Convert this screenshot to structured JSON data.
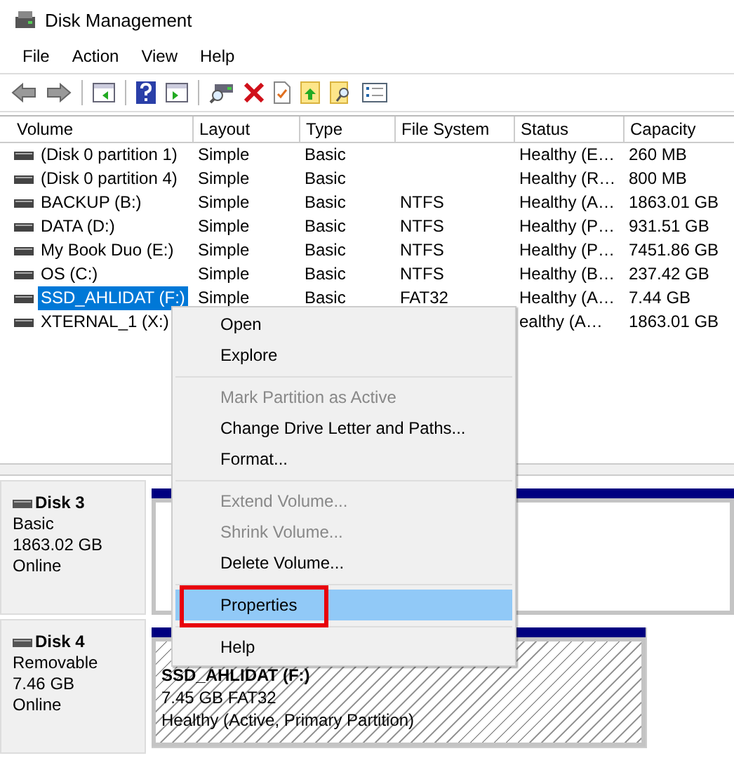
{
  "window": {
    "title": "Disk Management"
  },
  "menu_bar": [
    "File",
    "Action",
    "View",
    "Help"
  ],
  "toolbar": [
    {
      "kind": "back"
    },
    {
      "kind": "forward"
    },
    {
      "kind": "sep"
    },
    {
      "kind": "pane-left"
    },
    {
      "kind": "sep"
    },
    {
      "kind": "help"
    },
    {
      "kind": "pane-right"
    },
    {
      "kind": "sep"
    },
    {
      "kind": "connect"
    },
    {
      "kind": "delete"
    },
    {
      "kind": "check"
    },
    {
      "kind": "folder-up"
    },
    {
      "kind": "folder-search"
    },
    {
      "kind": "list"
    }
  ],
  "table": {
    "columns": [
      "Volume",
      "Layout",
      "Type",
      "File System",
      "Status",
      "Capacity"
    ],
    "rows": [
      {
        "cells": [
          "(Disk 0 partition 1)",
          "Simple",
          "Basic",
          null,
          "Healthy (E…",
          "260 MB"
        ],
        "selected": false
      },
      {
        "cells": [
          "(Disk 0 partition 4)",
          "Simple",
          "Basic",
          null,
          "Healthy (R…",
          "800 MB"
        ],
        "selected": false
      },
      {
        "cells": [
          "BACKUP (B:)",
          "Simple",
          "Basic",
          "NTFS",
          "Healthy (A…",
          "1863.01 GB"
        ],
        "selected": false
      },
      {
        "cells": [
          "DATA (D:)",
          "Simple",
          "Basic",
          "NTFS",
          "Healthy (P…",
          "931.51 GB"
        ],
        "selected": false
      },
      {
        "cells": [
          "My Book Duo (E:)",
          "Simple",
          "Basic",
          "NTFS",
          "Healthy (P…",
          "7451.86 GB"
        ],
        "selected": false
      },
      {
        "cells": [
          "OS (C:)",
          "Simple",
          "Basic",
          "NTFS",
          "Healthy (B…",
          "237.42 GB"
        ],
        "selected": false
      },
      {
        "cells": [
          "SSD_AHLIDAT (F:)",
          "Simple",
          "Basic",
          "FAT32",
          "Healthy (A…",
          "7.44 GB"
        ],
        "selected": true
      },
      {
        "cells": [
          "XTERNAL_1 (X:)",
          null,
          null,
          null,
          "ealthy (A…",
          "1863.01 GB"
        ],
        "selected": false
      }
    ]
  },
  "disks": [
    {
      "name": "Disk 3",
      "type": "Basic",
      "size": "1863.02 GB",
      "state": "Online",
      "partitions": [
        {
          "kind": "plain"
        }
      ]
    },
    {
      "name": "Disk 4",
      "type": "Removable",
      "size": "7.46 GB",
      "state": "Online",
      "partitions": [
        {
          "kind": "hatched",
          "lines": [
            "SSD_AHLIDAT (F:)",
            "7.45 GB FAT32",
            "Healthy (Active, Primary Partition)"
          ]
        }
      ]
    }
  ],
  "context_menu": [
    [
      {
        "label": "Open",
        "disabled": false,
        "selected": false,
        "outlined": false
      },
      {
        "label": "Explore",
        "disabled": false,
        "selected": false,
        "outlined": false
      }
    ],
    [
      {
        "label": "Mark Partition as Active",
        "disabled": true,
        "selected": false,
        "outlined": false
      },
      {
        "label": "Change Drive Letter and Paths...",
        "disabled": false,
        "selected": false,
        "outlined": false
      },
      {
        "label": "Format...",
        "disabled": false,
        "selected": false,
        "outlined": false
      }
    ],
    [
      {
        "label": "Extend Volume...",
        "disabled": true,
        "selected": false,
        "outlined": false
      },
      {
        "label": "Shrink Volume...",
        "disabled": true,
        "selected": false,
        "outlined": false
      },
      {
        "label": "Delete Volume...",
        "disabled": false,
        "selected": false,
        "outlined": false
      }
    ],
    [
      {
        "label": "Properties",
        "disabled": false,
        "selected": true,
        "outlined": true
      }
    ],
    [
      {
        "label": "Help",
        "disabled": false,
        "selected": false,
        "outlined": false
      }
    ]
  ]
}
